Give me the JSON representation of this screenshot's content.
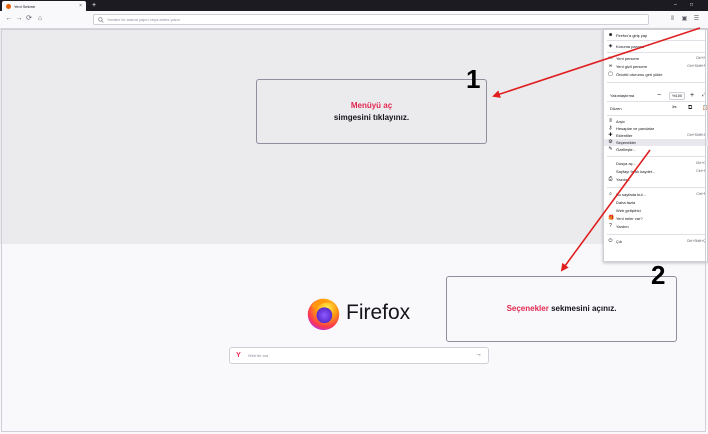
{
  "browser": {
    "tab_title": "Yeni Sekme",
    "tab_close": "×",
    "new_tab": "+",
    "window_controls": {
      "minimize": "–",
      "maximize": "□"
    },
    "nav": {
      "back": "←",
      "forward": "→",
      "reload": "⟳",
      "home": "⌂"
    },
    "url_placeholder": "Yandex ile arama yapın veya adres yazın"
  },
  "callouts": {
    "step1": {
      "number": "1",
      "highlight": "Menüyü aç",
      "text": "simgesini tıklayınız."
    },
    "step2": {
      "number": "2",
      "highlight": "Seçenekler",
      "text": "sekmesini açınız."
    }
  },
  "newtab_page": {
    "brand": "Firefox",
    "search_placeholder": "Web'de ara",
    "search_engine_letter": "Y"
  },
  "menu": {
    "items": [
      {
        "label": "Firefox'a giriş yap",
        "icon": "account-icon"
      },
      {
        "label": "Koruma panosu",
        "icon": "dashboard-icon"
      },
      {
        "label": "Yeni pencere",
        "icon": "window-icon",
        "shortcut": "Ctrl+N"
      },
      {
        "label": "Yeni gizli pencere",
        "icon": "private-window-icon",
        "shortcut": "Ctrl+Shift+P"
      },
      {
        "label": "Önceki oturumu geri yükle",
        "icon": "restore-icon"
      },
      {
        "label": "Arşiv",
        "icon": "library-icon"
      },
      {
        "label": "Hesaplar ve parolalar",
        "icon": "key-icon"
      },
      {
        "label": "Eklentiler",
        "icon": "addons-icon",
        "shortcut": "Ctrl+Shift+A"
      },
      {
        "label": "Seçenekler",
        "icon": "gear-icon"
      },
      {
        "label": "Özelleştir...",
        "icon": "customize-icon"
      },
      {
        "label": "Dosya aç...",
        "icon": "",
        "shortcut": "Ctrl+O"
      },
      {
        "label": "Sayfayı farklı kaydet...",
        "icon": "",
        "shortcut": "Ctrl+S"
      },
      {
        "label": "Yazdır...",
        "icon": "print-icon"
      },
      {
        "label": "Bu sayfada bul...",
        "icon": "search-icon",
        "shortcut": "Ctrl+F"
      },
      {
        "label": "Daha fazla",
        "icon": ""
      },
      {
        "label": "Web geliştirici",
        "icon": ""
      },
      {
        "label": "Yeni neler var?",
        "icon": "gift-icon"
      },
      {
        "label": "Yardım",
        "icon": "help-icon"
      },
      {
        "label": "Çık",
        "icon": "power-icon",
        "shortcut": "Ctrl+Shift+Q"
      }
    ],
    "zoom": {
      "label": "Yakınlaştırma",
      "minus": "−",
      "value": "%100",
      "plus": "+",
      "full": "⤢"
    },
    "edit": {
      "label": "Düzen",
      "cut": "✂",
      "copy": "⧉",
      "paste": "📋"
    }
  },
  "colors": {
    "accent_red": "#e22850",
    "arrow_red": "#e02020"
  }
}
